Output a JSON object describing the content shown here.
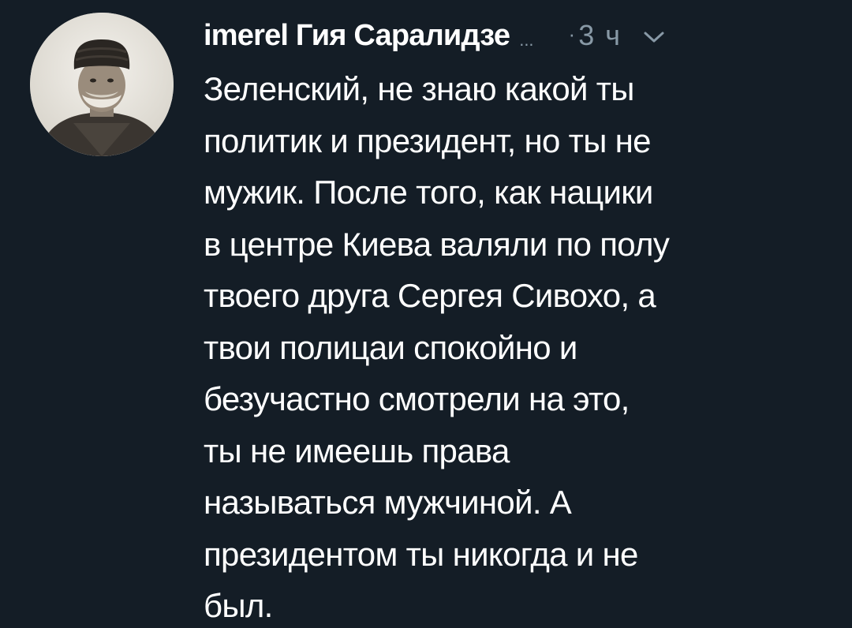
{
  "tweet": {
    "author": {
      "display_name": "imerel Гия Саралидзе",
      "truncation": "...",
      "avatar": "avatar-photo"
    },
    "meta": {
      "separator": "·",
      "time": "3 ч",
      "menu_icon": "chevron-down-icon"
    },
    "text_lines": [
      "Зеленский, не знаю какой ты",
      "политик и президент, но ты не",
      "мужик. После того, как нацики",
      "в центре Киева валяли по полу",
      "твоего друга Сергея Сивохо, а",
      "твои полицаи спокойно и",
      "безучастно смотрели на это,",
      "ты не имеешь права",
      "называться мужчиной. А",
      "президентом ты никогда и не",
      "был."
    ]
  },
  "colors": {
    "background": "#141d26",
    "primary_text": "#ffffff",
    "secondary_text": "#8899a6"
  }
}
